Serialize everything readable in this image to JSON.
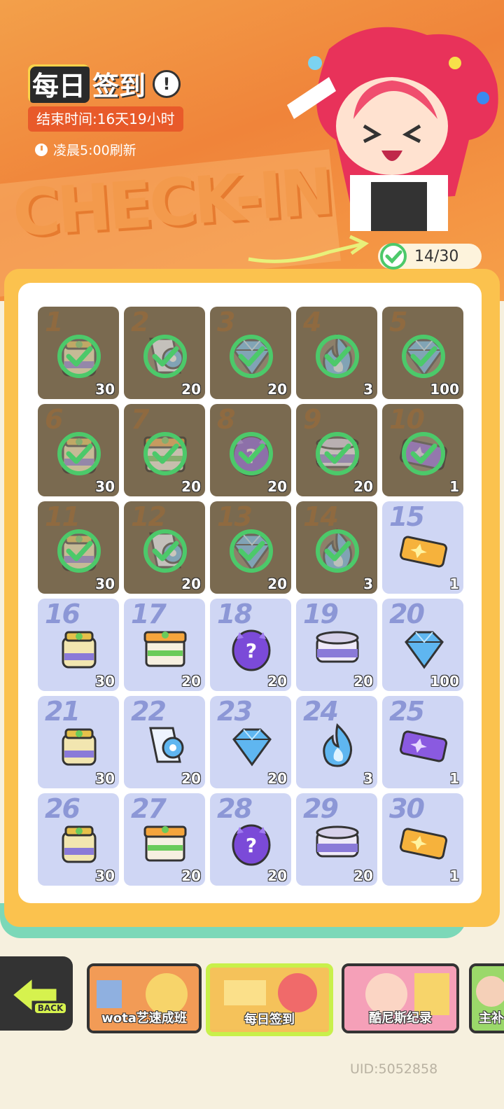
{
  "header": {
    "title_part1": "每日",
    "title_part2": "签到",
    "info_label": "!",
    "end_time": "结束时间:16天19小时",
    "refresh": "凌晨5:00刷新",
    "banner_text": "CHECK-IN",
    "progress": "14/30"
  },
  "rewards": [
    {
      "day": "1",
      "qty": "30",
      "item": "jar-icon",
      "claimed": true
    },
    {
      "day": "2",
      "qty": "20",
      "item": "ribbon-icon",
      "claimed": true
    },
    {
      "day": "3",
      "qty": "20",
      "item": "diamond-icon",
      "claimed": true
    },
    {
      "day": "4",
      "qty": "3",
      "item": "flame-icon",
      "claimed": true
    },
    {
      "day": "5",
      "qty": "100",
      "item": "diamond-icon",
      "claimed": true
    },
    {
      "day": "6",
      "qty": "30",
      "item": "jar-icon",
      "claimed": true
    },
    {
      "day": "7",
      "qty": "20",
      "item": "box-icon",
      "claimed": true
    },
    {
      "day": "8",
      "qty": "20",
      "item": "mystery-egg-icon",
      "claimed": true
    },
    {
      "day": "9",
      "qty": "20",
      "item": "can-icon",
      "claimed": true
    },
    {
      "day": "10",
      "qty": "1",
      "item": "purple-ticket-icon",
      "claimed": true
    },
    {
      "day": "11",
      "qty": "30",
      "item": "jar-icon",
      "claimed": true
    },
    {
      "day": "12",
      "qty": "20",
      "item": "ribbon-icon",
      "claimed": true
    },
    {
      "day": "13",
      "qty": "20",
      "item": "diamond-icon",
      "claimed": true
    },
    {
      "day": "14",
      "qty": "3",
      "item": "flame-icon",
      "claimed": true
    },
    {
      "day": "15",
      "qty": "1",
      "item": "gold-ticket-icon",
      "claimed": false
    },
    {
      "day": "16",
      "qty": "30",
      "item": "jar-icon",
      "claimed": false
    },
    {
      "day": "17",
      "qty": "20",
      "item": "box-icon",
      "claimed": false
    },
    {
      "day": "18",
      "qty": "20",
      "item": "mystery-egg-icon",
      "claimed": false
    },
    {
      "day": "19",
      "qty": "20",
      "item": "can-icon",
      "claimed": false
    },
    {
      "day": "20",
      "qty": "100",
      "item": "diamond-icon",
      "claimed": false
    },
    {
      "day": "21",
      "qty": "30",
      "item": "jar-icon",
      "claimed": false
    },
    {
      "day": "22",
      "qty": "20",
      "item": "ribbon-icon",
      "claimed": false
    },
    {
      "day": "23",
      "qty": "20",
      "item": "diamond-icon",
      "claimed": false
    },
    {
      "day": "24",
      "qty": "3",
      "item": "flame-icon",
      "claimed": false
    },
    {
      "day": "25",
      "qty": "1",
      "item": "purple-ticket-icon",
      "claimed": false
    },
    {
      "day": "26",
      "qty": "30",
      "item": "jar-icon",
      "claimed": false
    },
    {
      "day": "27",
      "qty": "20",
      "item": "box-icon",
      "claimed": false
    },
    {
      "day": "28",
      "qty": "20",
      "item": "mystery-egg-icon",
      "claimed": false
    },
    {
      "day": "29",
      "qty": "20",
      "item": "can-icon",
      "claimed": false
    },
    {
      "day": "30",
      "qty": "1",
      "item": "gold-ticket-icon",
      "claimed": false
    }
  ],
  "nav": {
    "back_label": "BACK",
    "tabs": [
      {
        "label": "wota艺速成班"
      },
      {
        "label": "每日签到"
      },
      {
        "label": "酷尼斯纪录"
      },
      {
        "label": "主补"
      }
    ]
  },
  "footer": {
    "uid": "UID:5052858"
  },
  "colors": {
    "banner": "#f0843a",
    "panel_border": "#fbc24e",
    "claimed_cell": "#7a6a50",
    "open_cell": "#cfd6f4",
    "check": "#4cc96a",
    "active_tab": "#c8f04a"
  }
}
